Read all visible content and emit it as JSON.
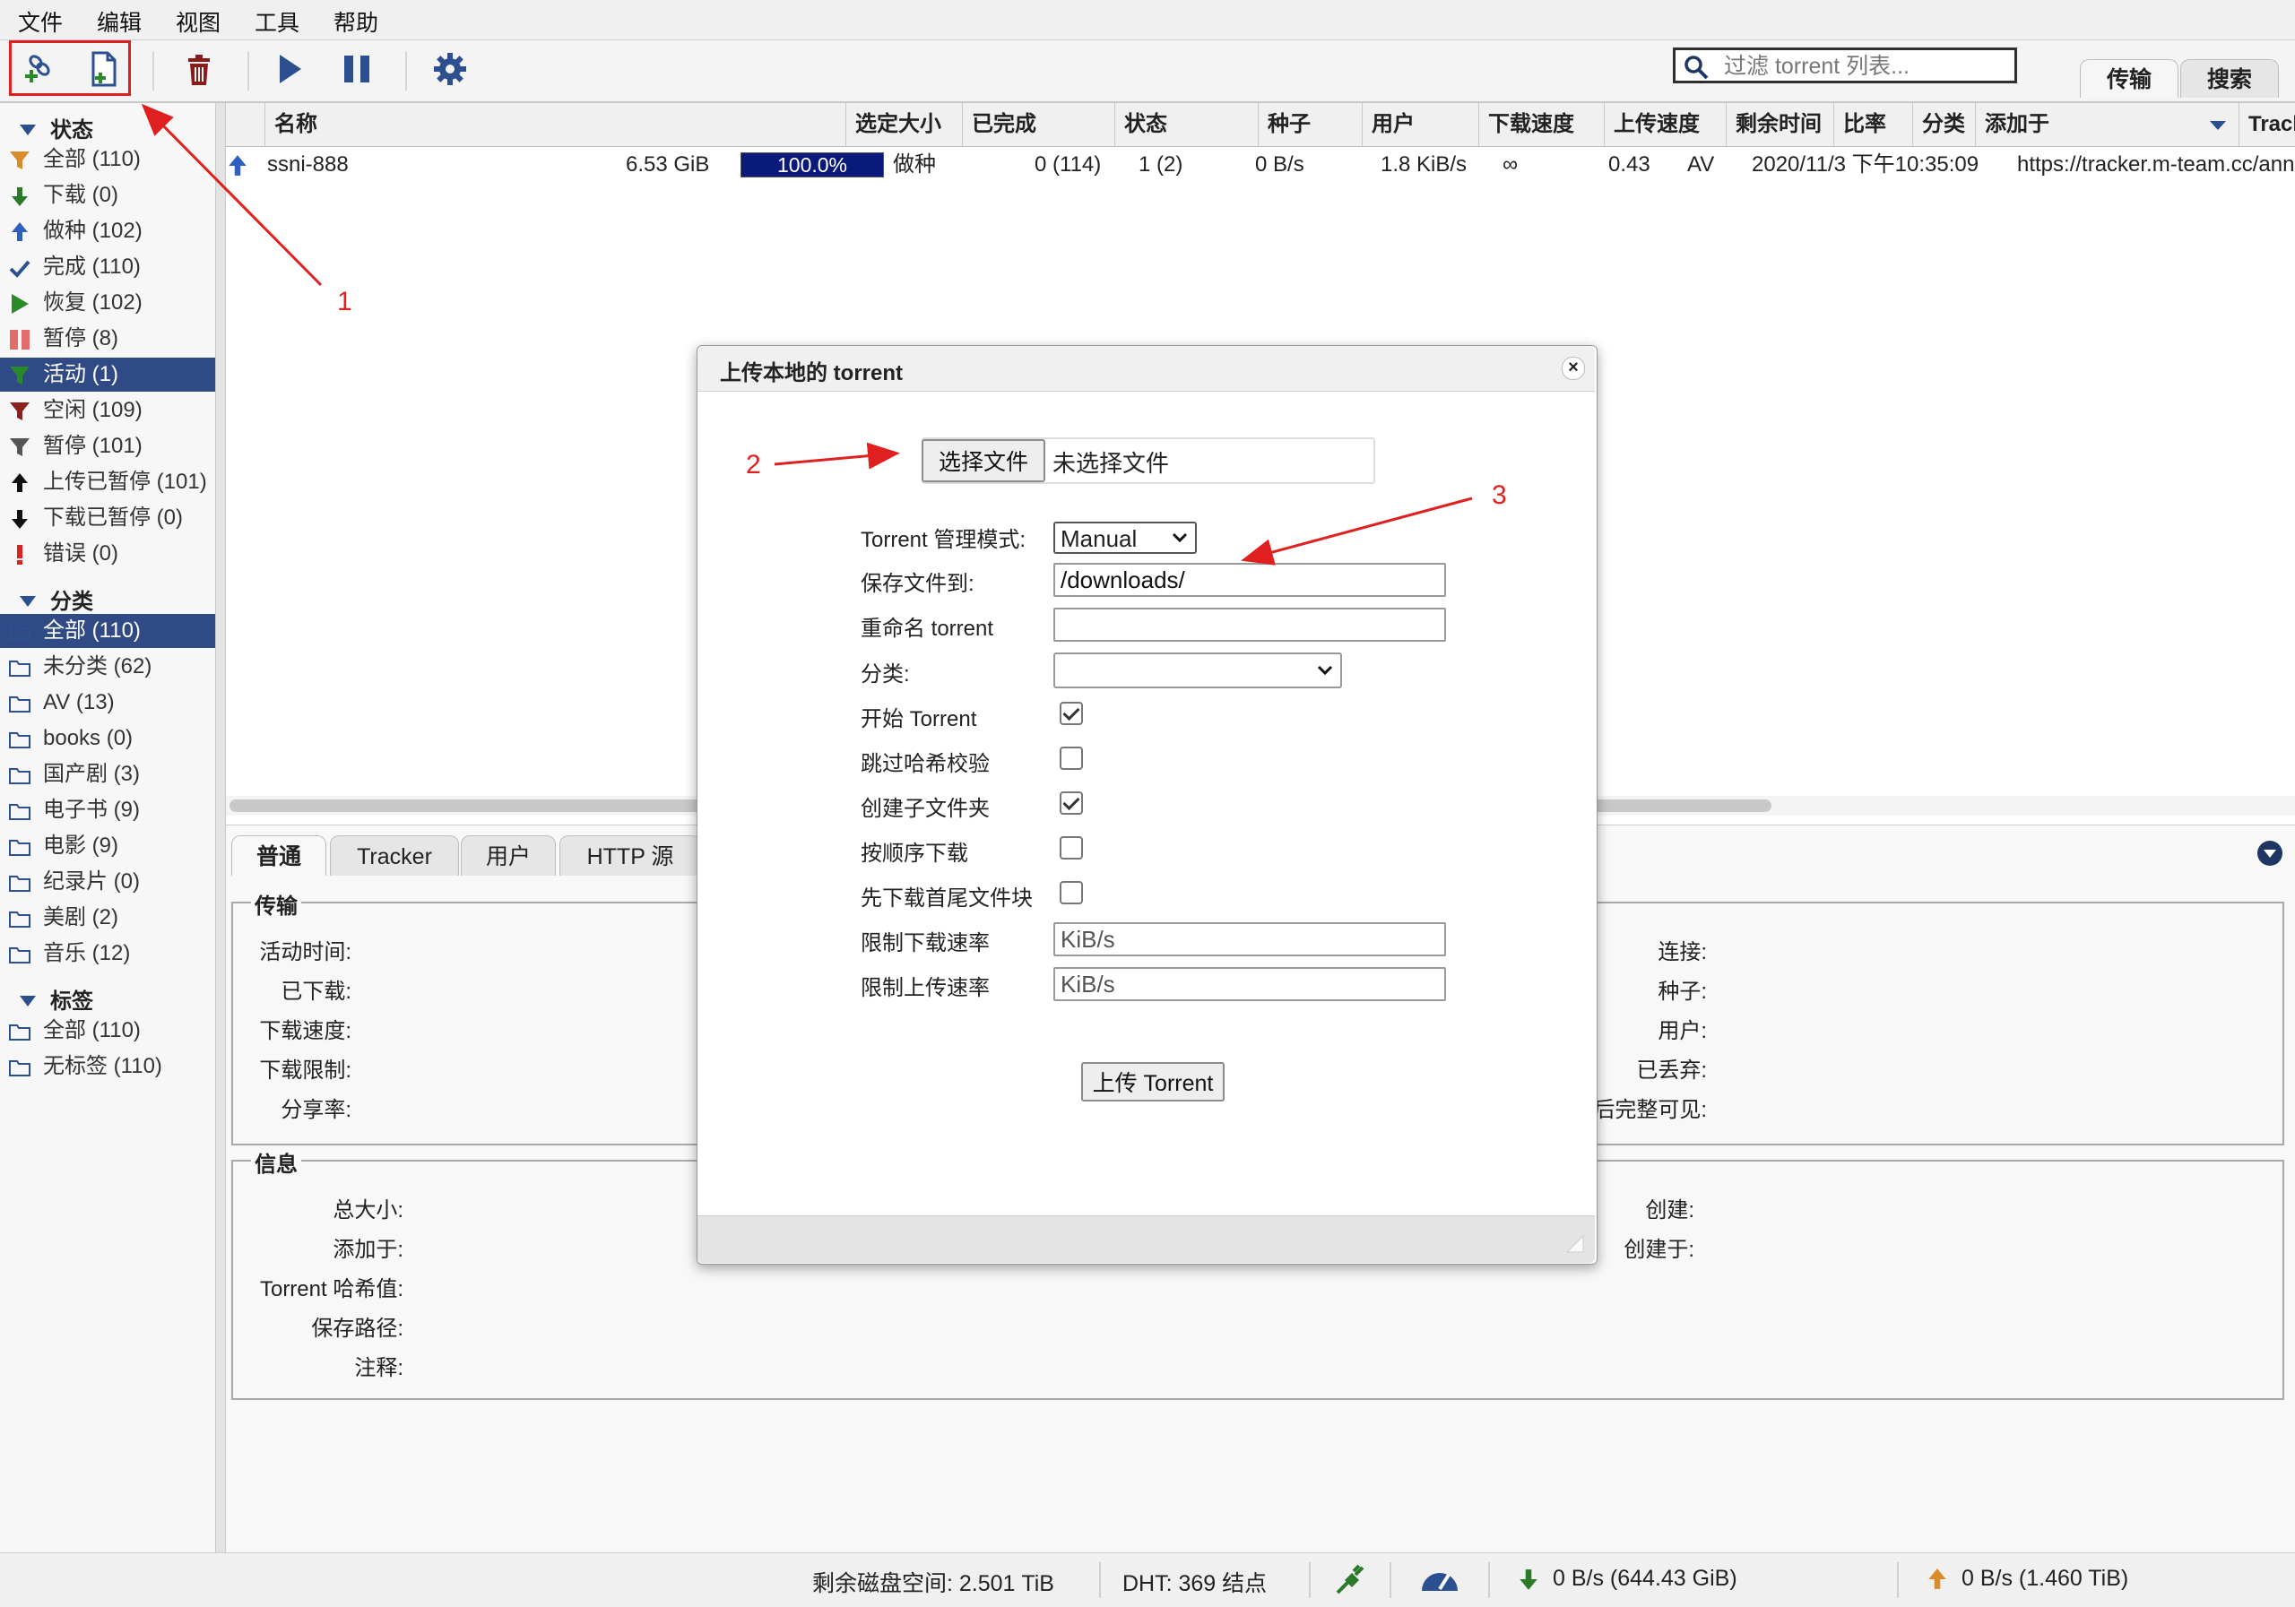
{
  "menu": [
    "文件",
    "编辑",
    "视图",
    "工具",
    "帮助"
  ],
  "toolbar": {
    "add_link_icon": "add-link-icon",
    "add_file_icon": "add-file-icon",
    "search_placeholder": "过滤 torrent 列表...",
    "tabs": [
      "传输",
      "搜索"
    ]
  },
  "sidebar": {
    "status_header": "状态",
    "status_items": [
      {
        "label": "全部 (110)",
        "icon": "funnel-icon"
      },
      {
        "label": "下载 (0)",
        "icon": "download-arrow-icon"
      },
      {
        "label": "做种 (102)",
        "icon": "upload-arrow-icon"
      },
      {
        "label": "完成 (110)",
        "icon": "check-icon"
      },
      {
        "label": "恢复 (102)",
        "icon": "play-icon"
      },
      {
        "label": "暂停 (8)",
        "icon": "pause-icon"
      },
      {
        "label": "活动 (1)",
        "icon": "funnel-icon",
        "selected": true
      },
      {
        "label": "空闲 (109)",
        "icon": "funnel-icon"
      },
      {
        "label": "暂停 (101)",
        "icon": "funnel-icon"
      },
      {
        "label": "上传已暂停 (101)",
        "icon": "upload-paused-icon"
      },
      {
        "label": "下载已暂停 (0)",
        "icon": "download-paused-icon"
      },
      {
        "label": "错误 (0)",
        "icon": "error-icon"
      }
    ],
    "category_header": "分类",
    "category_items": [
      {
        "label": "全部 (110)",
        "selected": true
      },
      {
        "label": "未分类 (62)"
      },
      {
        "label": "AV (13)"
      },
      {
        "label": "books (0)"
      },
      {
        "label": "国产剧 (3)"
      },
      {
        "label": "电子书 (9)"
      },
      {
        "label": "电影 (9)"
      },
      {
        "label": "纪录片 (0)"
      },
      {
        "label": "美剧 (2)"
      },
      {
        "label": "音乐 (12)"
      }
    ],
    "tag_header": "标签",
    "tag_items": [
      {
        "label": "全部 (110)"
      },
      {
        "label": "无标签 (110)"
      }
    ]
  },
  "table": {
    "columns": [
      "名称",
      "选定大小",
      "已完成",
      "状态",
      "种子",
      "用户",
      "下载速度",
      "上传速度",
      "剩余时间",
      "比率",
      "分类",
      "添加于",
      "Tracker"
    ],
    "rows": [
      {
        "name": "ssni-888",
        "size": "6.53 GiB",
        "progress_label": "100.0%",
        "progress": 1.0,
        "status": "做种",
        "seeds": "0 (114)",
        "peers": "1 (2)",
        "down_speed": "0 B/s",
        "up_speed": "1.8 KiB/s",
        "eta": "∞",
        "ratio": "0.43",
        "category": "AV",
        "added_on": "2020/11/3 下午10:35:09",
        "tracker": "https://tracker.m-team.cc/ann"
      }
    ]
  },
  "details": {
    "tabs": [
      "普通",
      "Tracker",
      "用户",
      "HTTP 源"
    ],
    "transfer_legend": "传输",
    "transfer_left": [
      "活动时间:",
      "已下载:",
      "下载速度:",
      "下载限制:",
      "分享率:"
    ],
    "transfer_right": [
      "连接:",
      "种子:",
      "用户:",
      "已丢弃:",
      "后完整可见:"
    ],
    "info_legend": "信息",
    "info_left": [
      "总大小:",
      "添加于:",
      "Torrent 哈希值:",
      "保存路径:",
      "注释:"
    ],
    "info_right": [
      "创建:",
      "创建于:"
    ]
  },
  "modal": {
    "title": "上传本地的 torrent",
    "choose_file_button": "选择文件",
    "no_file_text": "未选择文件",
    "mode_label": "Torrent 管理模式:",
    "mode_value": "Manual",
    "save_label": "保存文件到:",
    "save_value": "/downloads/",
    "rename_label": "重命名 torrent",
    "rename_value": "",
    "category_label": "分类:",
    "category_value": "",
    "start_label": "开始 Torrent",
    "start_checked": true,
    "skip_check_label": "跳过哈希校验",
    "skip_check_checked": false,
    "subfolder_label": "创建子文件夹",
    "subfolder_checked": true,
    "sequential_label": "按顺序下载",
    "sequential_checked": false,
    "first_last_label": "先下载首尾文件块",
    "first_last_checked": false,
    "dl_limit_label": "限制下载速率",
    "dl_limit_placeholder": "KiB/s",
    "ul_limit_label": "限制上传速率",
    "ul_limit_placeholder": "KiB/s",
    "upload_button": "上传 Torrent"
  },
  "statusbar": {
    "free_space": "剩余磁盘空间: 2.501 TiB",
    "dht": "DHT: 369 结点",
    "download": "0 B/s (644.43 GiB)",
    "upload": "0 B/s (1.460 TiB)"
  },
  "annotations": [
    "1",
    "2",
    "3"
  ],
  "colors": {
    "selection": "#2f4a85",
    "progress_fill": "#0a1a7a",
    "annotation_red": "#e02020"
  }
}
